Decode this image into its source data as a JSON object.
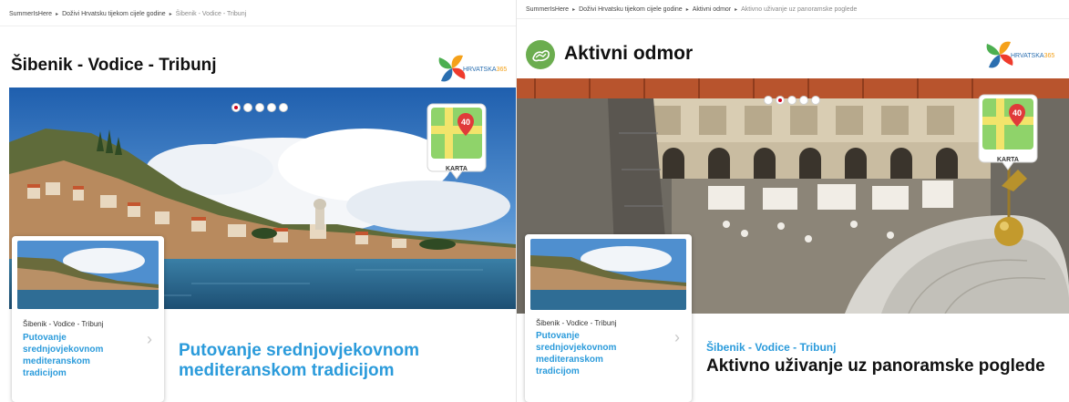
{
  "colors": {
    "accent_blue": "#2b9bdb",
    "active_dot_red": "#d0021b",
    "map_pin_red": "#e03a3a",
    "category_green": "#6bad4f"
  },
  "left": {
    "breadcrumb": [
      {
        "label": "SummerIsHere"
      },
      {
        "label": "Doživi Hrvatsku tijekom cijele godine"
      },
      {
        "label": "Šibenik - Vodice - Tribunj"
      }
    ],
    "page_title": "Šibenik - Vodice - Tribunj",
    "logo": {
      "name": "HRVATSKA",
      "number": "365"
    },
    "carousel": {
      "slide_count": 5,
      "active_index": 0
    },
    "map_badge": {
      "icon": "map-pin-icon",
      "count": "40",
      "label": "KARTA"
    },
    "card": {
      "place": "Šibenik - Vodice - Tribunj",
      "title": "Putovanje srednjovjekovnom mediteranskom tradicijom",
      "arrow": "›"
    },
    "headline": "Putovanje srednjovjekovnom mediteranskom tradicijom"
  },
  "right": {
    "breadcrumb": [
      {
        "label": "SummerIsHere"
      },
      {
        "label": "Doživi Hrvatsku tijekom cijele godine"
      },
      {
        "label": "Aktivni odmor"
      },
      {
        "label": "Aktivno uživanje uz panoramske poglede"
      }
    ],
    "category_icon": "hiking-icon",
    "page_title": "Aktivni odmor",
    "logo": {
      "name": "HRVATSKA",
      "number": "365"
    },
    "carousel": {
      "slide_count": 5,
      "active_index": 1
    },
    "map_badge": {
      "icon": "map-pin-icon",
      "count": "40",
      "label": "KARTA"
    },
    "card": {
      "place": "Šibenik - Vodice - Tribunj",
      "title": "Putovanje srednjovjekovnom mediteranskom tradicijom",
      "arrow": "›"
    },
    "subtitle": "Šibenik - Vodice - Tribunj",
    "headline": "Aktivno uživanje uz panoramske poglede"
  },
  "separator_glyph": "▸"
}
